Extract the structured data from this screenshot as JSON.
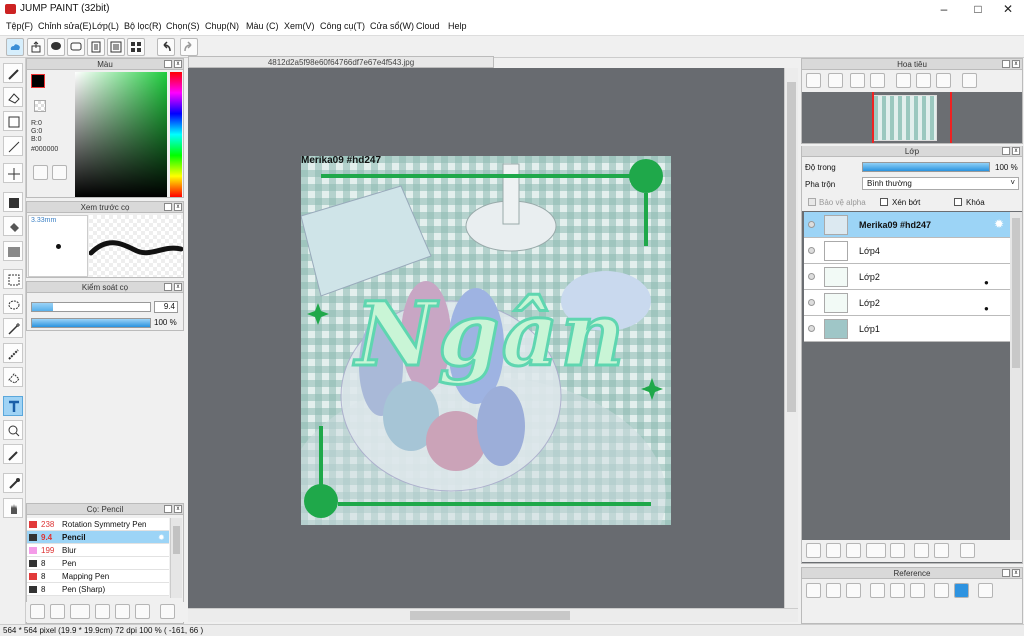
{
  "window": {
    "title": "JUMP PAINT (32bit)"
  },
  "menu": [
    "Tệp(F)",
    "Chỉnh sửa(E)",
    "Lớp(L)",
    "Bộ lọc(R)",
    "Chọn(S)",
    "Chụp(N)",
    "Màu (C)",
    "Xem(V)",
    "Công cụ(T)",
    "Cửa sổ(W)",
    "Cloud",
    "Help"
  ],
  "document": {
    "tab_title": "4812d2a5f98e60f64766df7e67e4f543.jpg"
  },
  "color_panel": {
    "title": "Màu",
    "r": "R:0",
    "g": "G:0",
    "b": "B:0",
    "hex": "#000000",
    "foreground": "#000000",
    "background": "#ffffff"
  },
  "preview_panel": {
    "title": "Xem trước cọ",
    "size": "3.33mm"
  },
  "brush_control": {
    "title": "Kiểm soát cọ",
    "size_value": "9.4",
    "opacity_value": "100 %"
  },
  "brush_list": {
    "title": "Cọ: Pencil",
    "items": [
      {
        "size": "238",
        "name": "Rotation Symmetry Pen",
        "color": "#e23a3a"
      },
      {
        "size": "9.4",
        "name": "Pencil",
        "color": "#333333"
      },
      {
        "size": "199",
        "name": "Blur",
        "color": "#f49be8"
      },
      {
        "size": "8",
        "name": "Pen",
        "color": "#333333"
      },
      {
        "size": "8",
        "name": "Mapping Pen",
        "color": "#e23a3a"
      },
      {
        "size": "8",
        "name": "Pen (Sharp)",
        "color": "#333333"
      }
    ]
  },
  "navigator": {
    "title": "Hoa tiêu"
  },
  "layer_panel": {
    "title": "Lớp",
    "opacity_label": "Độ trong",
    "opacity_value": "100 %",
    "blend_label": "Pha trộn",
    "blend_value": "Bình thường",
    "protect_alpha": "Bảo vệ alpha",
    "clipping": "Xén bớt",
    "lock": "Khóa",
    "layers": [
      {
        "name": "Merika09  #hd247",
        "selected": true
      },
      {
        "name": "Lớp4",
        "selected": false
      },
      {
        "name": "Lớp2",
        "selected": false
      },
      {
        "name": "Lớp2",
        "selected": false
      },
      {
        "name": "Lớp1",
        "selected": false
      }
    ]
  },
  "reference_panel": {
    "title": "Reference"
  },
  "artwork": {
    "watermark": "Merika09  #hd247",
    "headline": "Ngân"
  },
  "status": {
    "text": "564 * 564 pixel   (19.9 * 19.9cm)  72 dpi  100 %   ( -161, 66 )"
  },
  "colors": {
    "accent": "#1fa84a",
    "selection": "#9cd4f6",
    "canvas_bg": "#686b70"
  }
}
